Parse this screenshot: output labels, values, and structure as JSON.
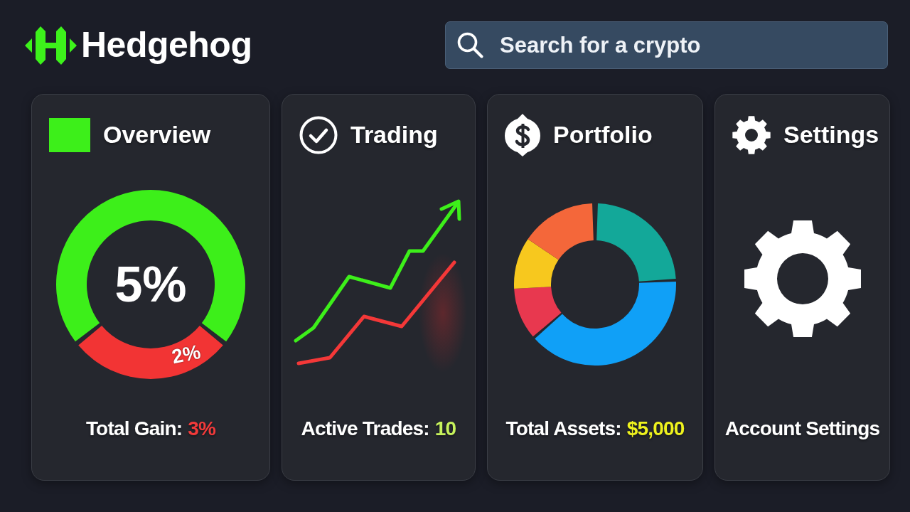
{
  "logo": {
    "text": "Hedgehog"
  },
  "search": {
    "placeholder": "Search for a crypto"
  },
  "cards": [
    {
      "kind": "ring",
      "title": "Overview",
      "chart_data": {
        "type": "donut",
        "values": [
          5,
          2
        ],
        "value_labels": [
          "5%",
          "2%"
        ]
      },
      "stat": {
        "label": "Total Gain:",
        "value": "3%",
        "color": "#f23a3a"
      }
    },
    {
      "kind": "lines",
      "title": "Trading",
      "stat": {
        "label": "Active Trades:",
        "value": "10",
        "color": "#c6f25c"
      }
    },
    {
      "kind": "pie",
      "title": "Portfolio",
      "stat": {
        "label": "Total Assets:",
        "value": "$5,000",
        "color": "#eef21e"
      }
    },
    {
      "kind": "gear",
      "title": "Settings",
      "stat": {
        "label": "Account Settings"
      }
    }
  ]
}
